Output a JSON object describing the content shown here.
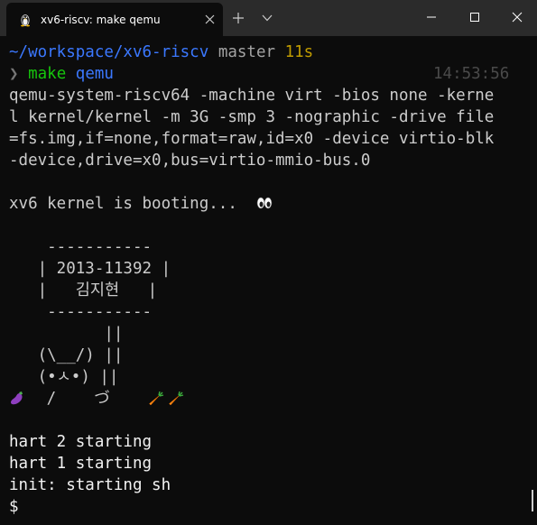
{
  "window": {
    "tab_title": "xv6-riscv: make qemu",
    "tab_icon": "linux-penguin-icon",
    "new_tab_icon": "plus-icon",
    "dropdown_icon": "chevron-down-icon",
    "minimize_icon": "minimize-icon",
    "maximize_icon": "maximize-icon",
    "close_icon": "close-icon"
  },
  "prompt": {
    "path": "~/workspace/xv6-riscv",
    "branch": "master",
    "duration": "11s",
    "symbol": "❯",
    "command": "make",
    "argument": "qemu",
    "clock": "14:53:56"
  },
  "output": {
    "qemu_cmd_lines": [
      "qemu-system-riscv64 -machine virt -bios none -kerne",
      "l kernel/kernel -m 3G -smp 3 -nographic -drive file",
      "=fs.img,if=none,format=raw,id=x0 -device virtio-blk",
      "-device,drive=x0,bus=virtio-mmio-bus.0"
    ],
    "boot_message": "xv6 kernel is booting...",
    "banner": {
      "top_border": "    -----------",
      "id_line": "   | 2013-11392 |",
      "name_line": "   |   김지현   |",
      "bottom_border": "    -----------",
      "art_1": "          ||",
      "art_2": "   (\\__/) ||",
      "art_3": "   (•ㅅ•) ||",
      "art_4": "   /    づ"
    },
    "hart_2": "hart 2 starting",
    "hart_1": "hart 1 starting",
    "init": "init: starting sh",
    "shell_prompt": "$"
  },
  "colors": {
    "background": "#0c0c0c",
    "titlebar": "#2b2b2b",
    "foreground": "#cccccc",
    "path": "#3b78ff",
    "command": "#16c60c",
    "duration": "#c19c00"
  }
}
